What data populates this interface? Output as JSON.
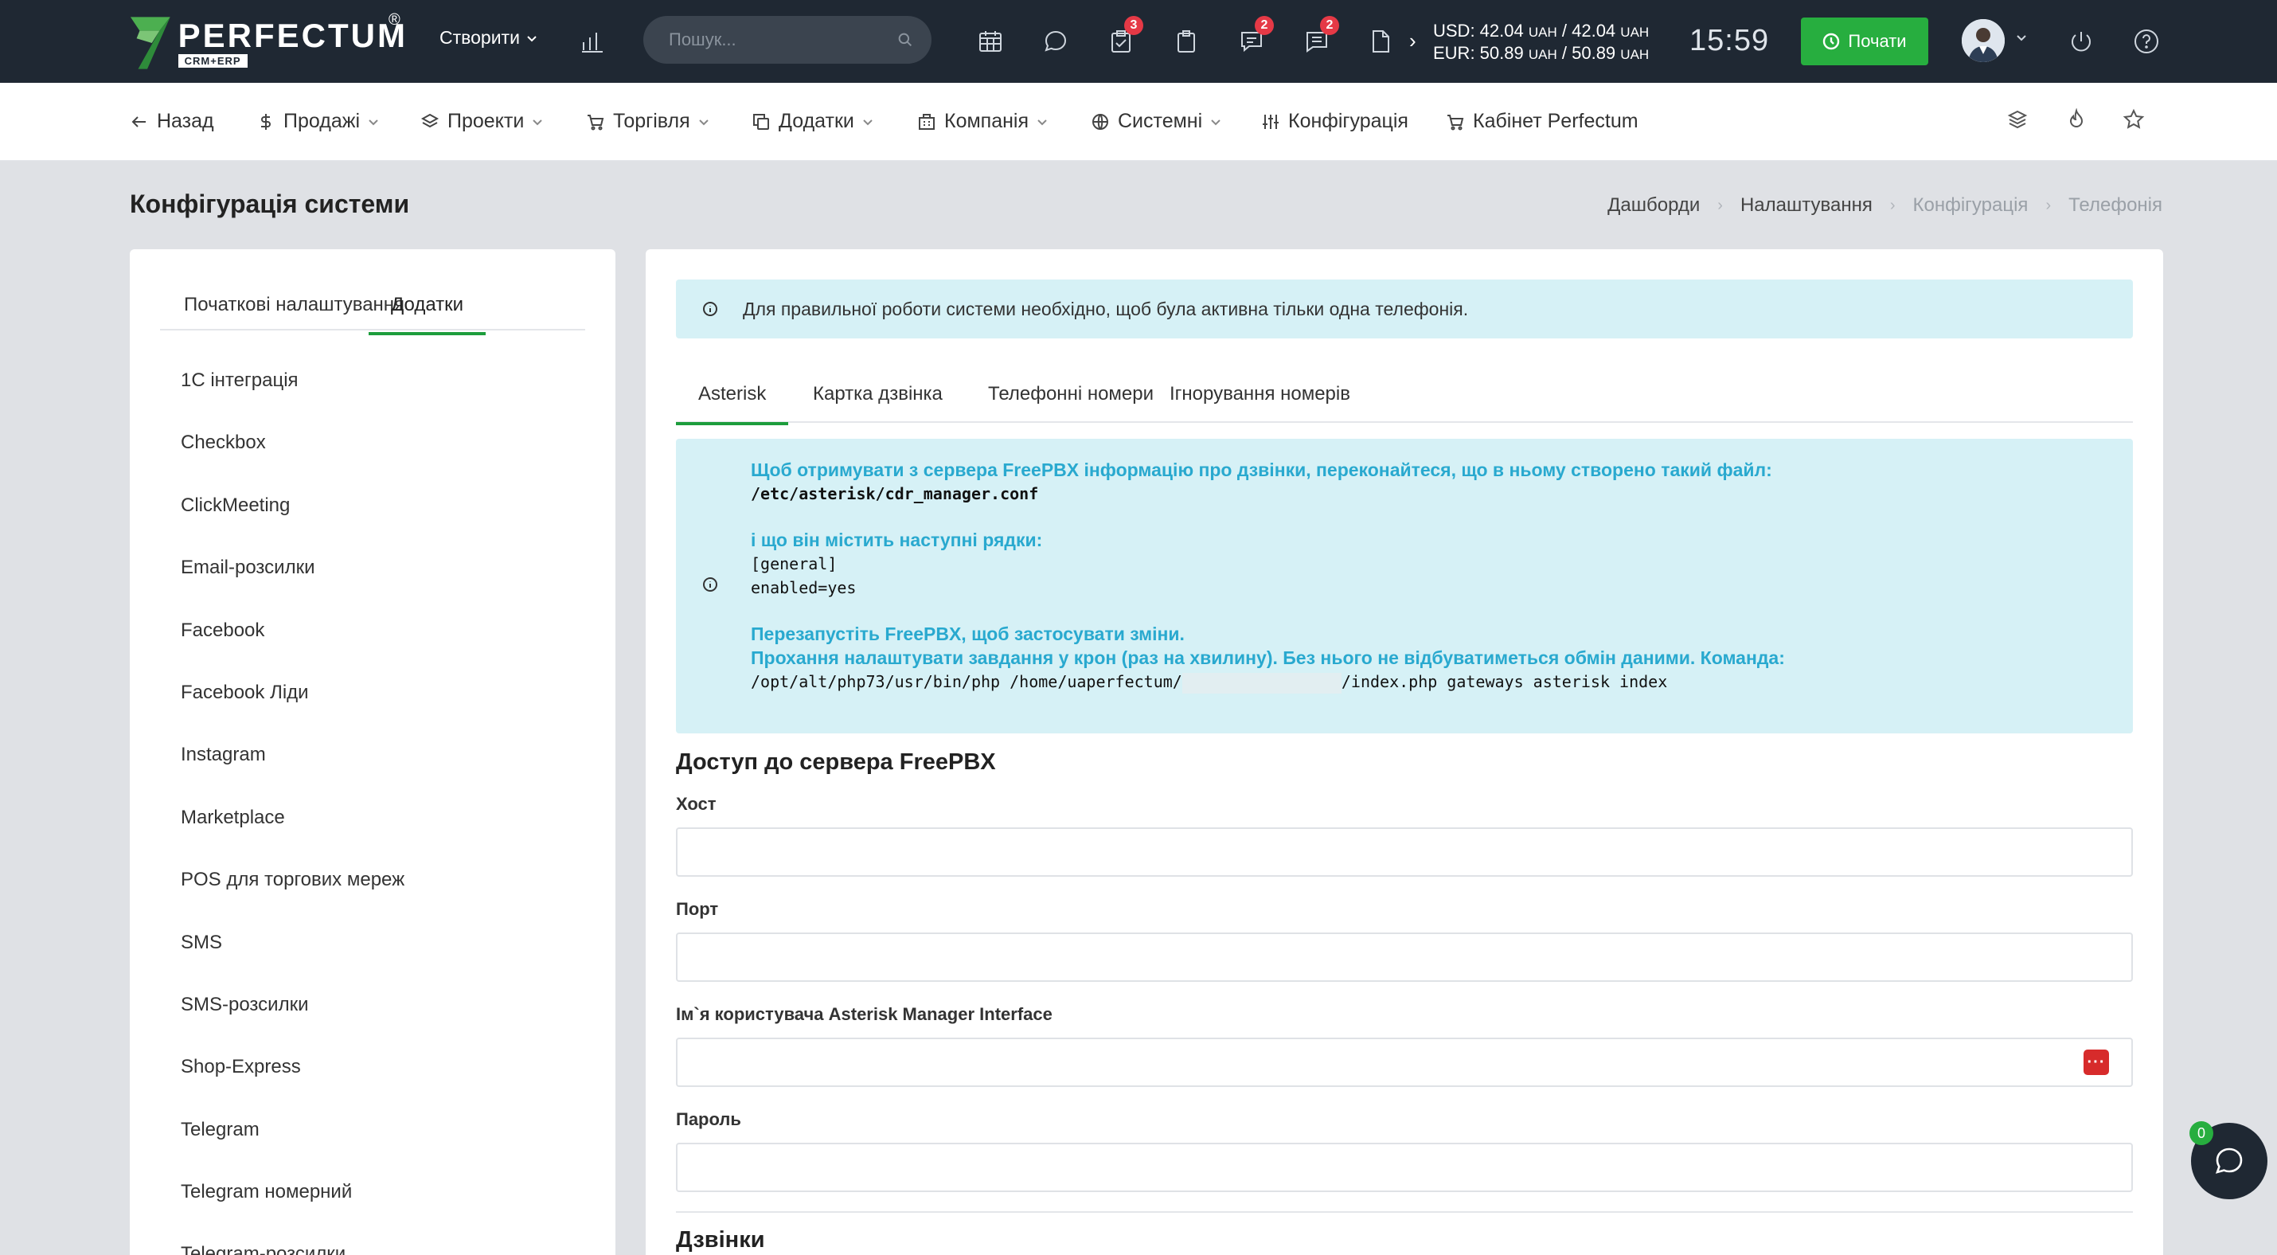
{
  "header": {
    "logo_word": "PERFECTUM",
    "logo_reg": "®",
    "logo_sub": "CRM+ERP",
    "create_label": "Створити",
    "search_placeholder": "Пошук...",
    "badges": {
      "tasks": "3",
      "messages": "2",
      "comments": "2"
    },
    "usd_rate": "USD: 42.04",
    "usd_rate2": "/ 42.04",
    "eur_rate": "EUR: 50.89",
    "eur_rate2": "/ 50.89",
    "currency_unit": "UAH",
    "time": "15:59",
    "start_label": "Почати"
  },
  "nav": {
    "back": "Назад",
    "sales": "Продажі",
    "projects": "Проекти",
    "trade": "Торгівля",
    "addons": "Додатки",
    "company": "Компанія",
    "system": "Системні",
    "config": "Конфігурація",
    "cabinet": "Кабінет Perfectum"
  },
  "page": {
    "title": "Конфігурація системи",
    "breadcrumb": [
      "Дашборди",
      "Налаштування",
      "Конфігурація",
      "Телефонія"
    ]
  },
  "sidebar": {
    "tabs": [
      "Початкові налаштування",
      "Додатки"
    ],
    "items": [
      "1С інтеграція",
      "Checkbox",
      "ClickMeeting",
      "Email-розсилки",
      "Facebook",
      "Facebook Ліди",
      "Instagram",
      "Marketplace",
      "POS для торгових мереж",
      "SMS",
      "SMS-розсилки",
      "Shop-Express",
      "Telegram",
      "Telegram номерний",
      "Telegram-розсилки"
    ]
  },
  "main": {
    "alert": "Для правильної роботи системи необхідно, щоб була активна тільки одна телефонія.",
    "tabs": [
      "Asterisk",
      "Картка дзвінка",
      "Телефонні номери",
      "Ігнорування номерів"
    ],
    "info": {
      "line1": "Щоб отримувати з сервера FreePBX інформацію про дзвінки, переконайтеся, що в ньому створено такий файл:",
      "line2": "/etc/asterisk/cdr_manager.conf",
      "line3": "і що він містить наступні рядки:",
      "line4": "[general]",
      "line5": "enabled=yes",
      "line6": "Перезапустіть FreePBX, щоб застосувати зміни.",
      "line7": "Прохання налаштувати завдання у крон (раз на хвилину). Без нього не відбуватиметься обмін даними. Команда:",
      "line8a": "/opt/alt/php73/usr/bin/php /home/uaperfectum/",
      "line8b": "/index.php gateways asterisk index"
    },
    "section_access": "Доступ до сервера FreePBX",
    "host_label": "Хост",
    "port_label": "Порт",
    "ami_user_label": "Ім`я користувача Asterisk Manager Interface",
    "password_label": "Пароль",
    "section_calls": "Дзвінки",
    "kp_label": "···"
  },
  "chat": {
    "badge": "0"
  }
}
